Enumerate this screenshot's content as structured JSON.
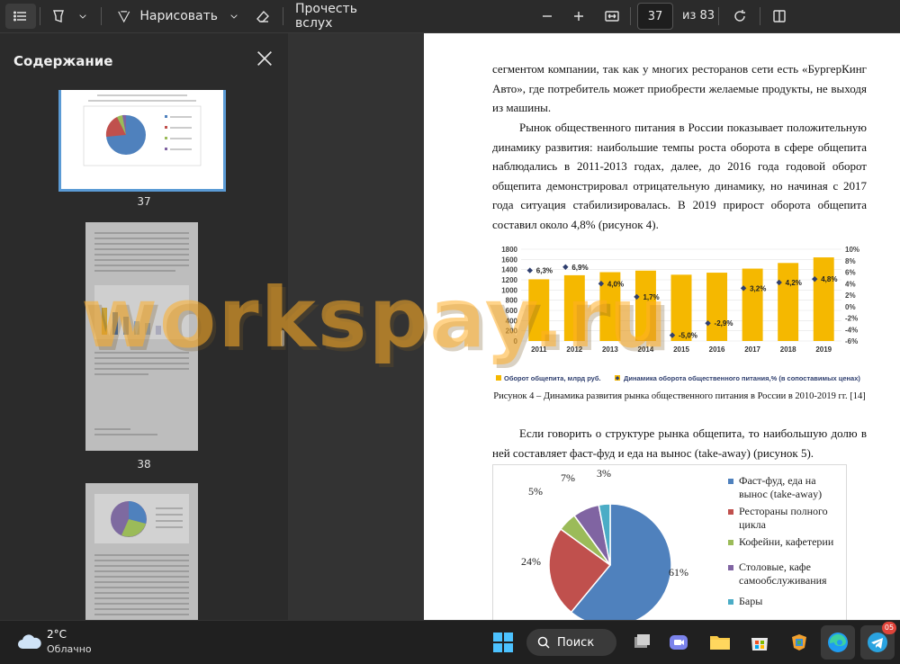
{
  "toolbar": {
    "draw_label": "Нарисовать",
    "read_aloud_label": "Прочесть вслух",
    "page_current": "37",
    "page_total_label": "из 83"
  },
  "sidebar": {
    "title": "Содержание",
    "thumbnails": [
      {
        "page": "37"
      },
      {
        "page": "38"
      }
    ]
  },
  "document": {
    "para1": "сегментом компании, так как у многих ресторанов сети есть «БургерКинг Авто», где потребитель может приобрести желаемые продукты, не выходя из машины.",
    "para2": "Рынок общественного питания в России показывает положительную динамику развития: наибольшие темпы роста оборота в сфере общепита наблюдались в 2011-2013 годах, далее, до 2016 года годовой оборот общепита демонстрировал отрицательную динамику, но начиная с 2017 года ситуация стабилизировалась. В 2019 прирост оборота общепита составил около 4,8% (рисунок 4).",
    "caption4": "Рисунок 4 – Динамика развития рынка общественного питания в России в 2010-2019 гг. [14]",
    "para3": "Если говорить о структуре рынка общепита, то наибольшую долю в ней составляет фаст-фуд и еда на вынос (take-away) (рисунок 5).",
    "watermark": "workspay.ru"
  },
  "chart_data": [
    {
      "type": "bar",
      "categories": [
        "2011",
        "2012",
        "2013",
        "2014",
        "2015",
        "2016",
        "2017",
        "2018",
        "2019"
      ],
      "series": [
        {
          "name": "Оборот общепита, млрд руб.",
          "values": [
            1210,
            1290,
            1350,
            1380,
            1300,
            1340,
            1420,
            1530,
            1640
          ],
          "color": "#f5b800"
        },
        {
          "name": "Динамика оборота общественного питания,% (в сопоставимых ценах)",
          "values": [
            6.3,
            6.9,
            4.0,
            1.7,
            -5.0,
            -2.9,
            3.2,
            4.2,
            4.8
          ],
          "color": "#2f3f6f",
          "axis": "right"
        }
      ],
      "point_labels": [
        "6,3%",
        "6,9%",
        "4,0%",
        "1,7%",
        "-5,0%",
        "-2,9%",
        "3,2%",
        "4,2%",
        "4,8%"
      ],
      "yticks_left": [
        "0",
        "200",
        "400",
        "600",
        "800",
        "1000",
        "1200",
        "1400",
        "1600",
        "1800"
      ],
      "yticks_right": [
        "-6%",
        "-4%",
        "-2%",
        "0%",
        "2%",
        "4%",
        "6%",
        "8%",
        "10%"
      ],
      "ylim_left": [
        0,
        1800
      ],
      "ylim_right": [
        -6,
        10
      ]
    },
    {
      "type": "pie",
      "labels": [
        "Фаст-фуд, еда на вынос (take-away)",
        "Рестораны полного цикла",
        "Кофейни, кафетерии",
        "Столовые, кафе самообслуживания",
        "Бары"
      ],
      "values": [
        61,
        24,
        5,
        7,
        3
      ],
      "value_labels": [
        "61%",
        "24%",
        "5%",
        "7%",
        "3%"
      ],
      "colors": [
        "#4f81bd",
        "#c0504d",
        "#9bbb59",
        "#8064a2",
        "#4bacc6"
      ]
    }
  ],
  "taskbar": {
    "temperature": "2°C",
    "weather": "Облачно",
    "search_label": "Поиск",
    "telegram_badge": "05"
  }
}
